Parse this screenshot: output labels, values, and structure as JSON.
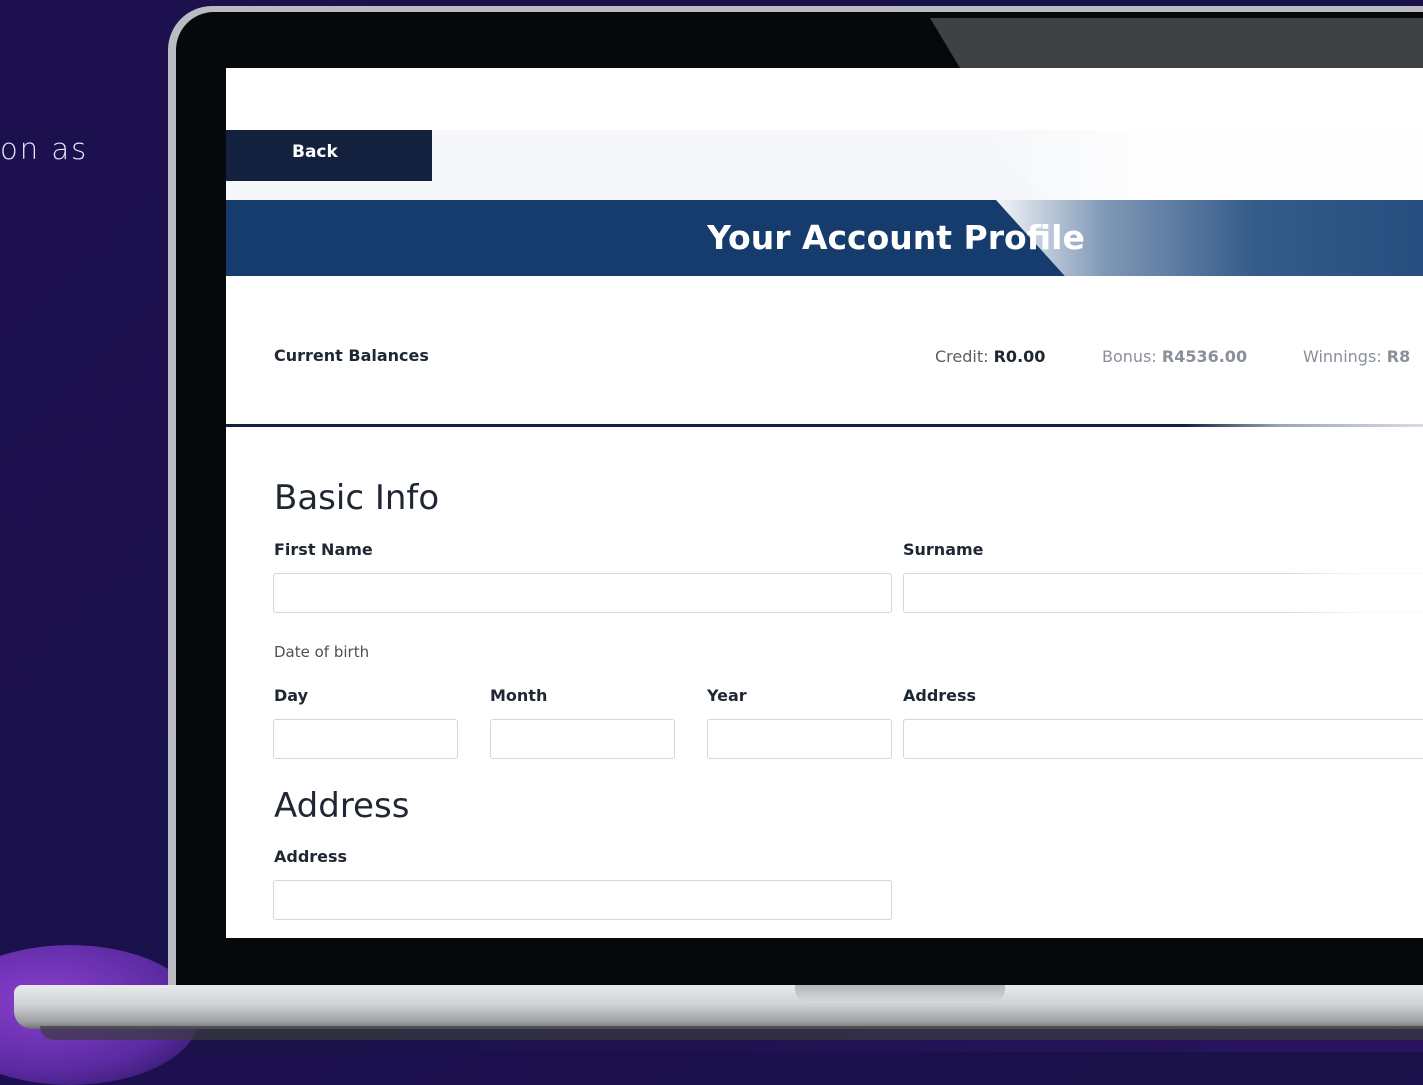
{
  "background": {
    "text": "on as",
    "colors": {
      "background": "#1c1050",
      "accent": "#8b3fd0"
    }
  },
  "screen": {
    "back_label": "Back",
    "title": "Your Account Profile",
    "colors": {
      "banner": "#163c6e",
      "back_button": "#13213f"
    },
    "balances": {
      "heading": "Current Balances",
      "credit_label": "Credit:",
      "credit_value": "R0.00",
      "bonus_label": "Bonus:",
      "bonus_value": "R4536.00",
      "winnings_label": "Winnings:",
      "winnings_value": "R8"
    },
    "basic_info": {
      "title": "Basic Info",
      "first_name_label": "First Name",
      "first_name_value": "",
      "surname_label": "Surname",
      "surname_value": "",
      "dob_label": "Date of birth",
      "day_label": "Day",
      "day_value": "",
      "month_label": "Month",
      "month_value": "",
      "year_label": "Year",
      "year_value": "",
      "address_label": "Address",
      "address_value": ""
    },
    "address_section": {
      "title": "Address",
      "address_label": "Address",
      "address_value": ""
    }
  }
}
